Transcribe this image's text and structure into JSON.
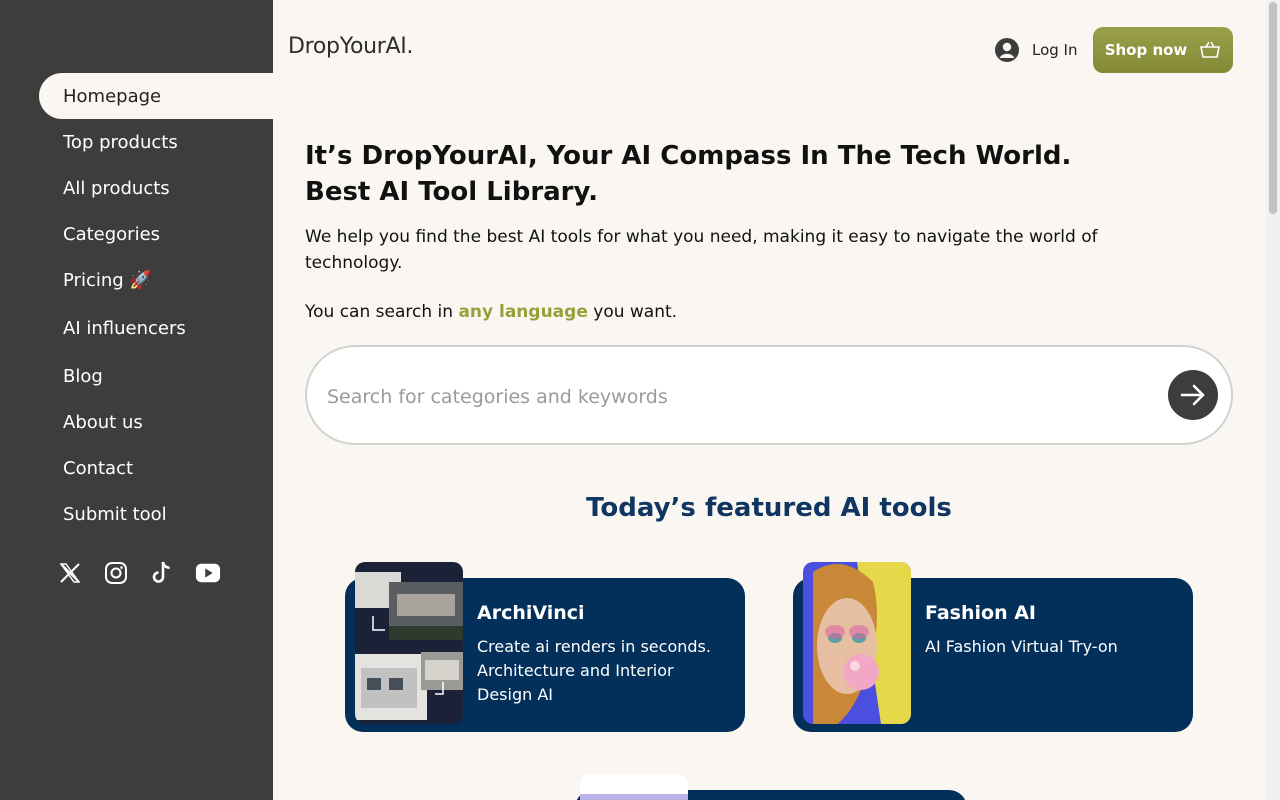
{
  "logo": "DropYourAI.",
  "header": {
    "login_label": "Log In",
    "shop_label": "Shop now"
  },
  "sidebar": {
    "items": [
      {
        "label": "Homepage",
        "active": true
      },
      {
        "label": "Top products"
      },
      {
        "label": "All products"
      },
      {
        "label": "Categories"
      },
      {
        "label": "Pricing 🚀"
      },
      {
        "label": "AI influencers"
      },
      {
        "label": "Blog"
      },
      {
        "label": "About us"
      },
      {
        "label": "Contact"
      },
      {
        "label": "Submit tool"
      }
    ],
    "socials": [
      "x-icon",
      "instagram-icon",
      "tiktok-icon",
      "youtube-icon"
    ]
  },
  "hero": {
    "title_line1": "It’s DropYourAI, Your AI Compass In The Tech World.",
    "title_line2": "Best AI Tool Library.",
    "description": "We help you find the best AI tools for what you need, making it easy to navigate the world of technology.",
    "lang_prefix": "You can search in ",
    "lang_highlight": "any language",
    "lang_suffix": " you want."
  },
  "search": {
    "placeholder": "Search for categories and keywords",
    "value": ""
  },
  "featured": {
    "title": "Today’s featured AI tools",
    "cards": [
      {
        "name": "ArchiVinci",
        "description": "Create ai renders in seconds. Architecture and Interior Design AI"
      },
      {
        "name": "Fashion AI",
        "description": "AI Fashion Virtual Try-on"
      }
    ]
  },
  "colors": {
    "sidebar_bg": "#3d3d3d",
    "accent_olive": "#98a03a",
    "card_navy": "#02305a",
    "page_bg": "#faf7f2"
  }
}
